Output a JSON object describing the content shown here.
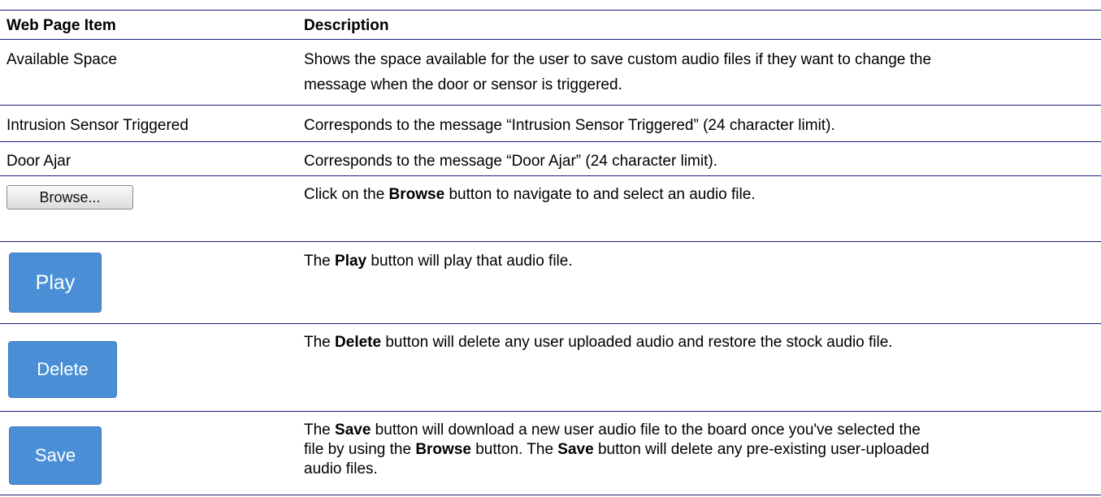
{
  "header": {
    "col1": "Web Page Item",
    "col2": "Description"
  },
  "rows": [
    {
      "item": "Available Space",
      "line1": "Shows the space available for the user to save custom audio files if they want to change the",
      "line2": "message when the door or sensor is triggered."
    },
    {
      "item": "Intrusion Sensor Triggered",
      "desc": "Corresponds to the message “Intrusion Sensor Triggered” (24 character limit)."
    },
    {
      "item": "Door Ajar",
      "desc": "Corresponds to the message “Door Ajar” (24 character limit)."
    },
    {
      "button": "Browse...",
      "pre": "Click on the ",
      "bold": "Browse",
      "post": " button to navigate to and select an audio file."
    },
    {
      "button": "Play",
      "pre": "The ",
      "bold": "Play",
      "post": " button will play that audio file."
    },
    {
      "button": "Delete",
      "pre": "The ",
      "bold": "Delete",
      "post": " button will delete any user uploaded audio and restore the stock audio file."
    },
    {
      "button": "Save",
      "l1_pre": "The ",
      "l1_bold": "Save",
      "l1_post": " button will download a new user audio file to the board once you've selected the",
      "l2_pre": "file by using the ",
      "l2_bold1": "Browse",
      "l2_mid": " button. The ",
      "l2_bold2": "Save",
      "l2_post": " button will delete any pre-existing user-uploaded",
      "l3": "audio files."
    }
  ],
  "colors": {
    "rule": "#1a1f7a",
    "button_blue": "#4a8fd5",
    "button_text": "#ffffff"
  }
}
